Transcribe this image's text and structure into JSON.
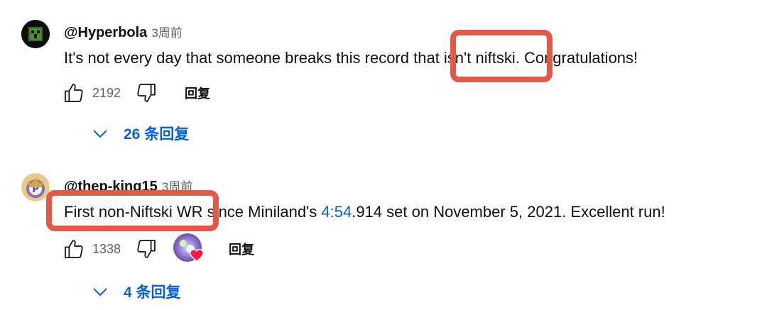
{
  "comments": [
    {
      "handle": "@Hyperbola",
      "time": "3周前",
      "text_before": "It's not every day that someone breaks this record that ",
      "text_highlight": "isn't niftski",
      "text_after": ". Congratulations!",
      "likes": "2192",
      "reply_label": "回复",
      "replies_label": "26 条回复"
    },
    {
      "handle": "@thep-king15",
      "time": "3周前",
      "text_highlight": "First non-Niftski WR",
      "text_before": " since Miniland's ",
      "timestamp": "4:54",
      "text_after": ".914 set on November 5, 2021. Excellent run!",
      "likes": "1338",
      "reply_label": "回复",
      "replies_label": "4 条回复"
    }
  ],
  "colors": {
    "highlight": "#e05a47",
    "link": "#065fd4",
    "secondary": "#606060"
  }
}
